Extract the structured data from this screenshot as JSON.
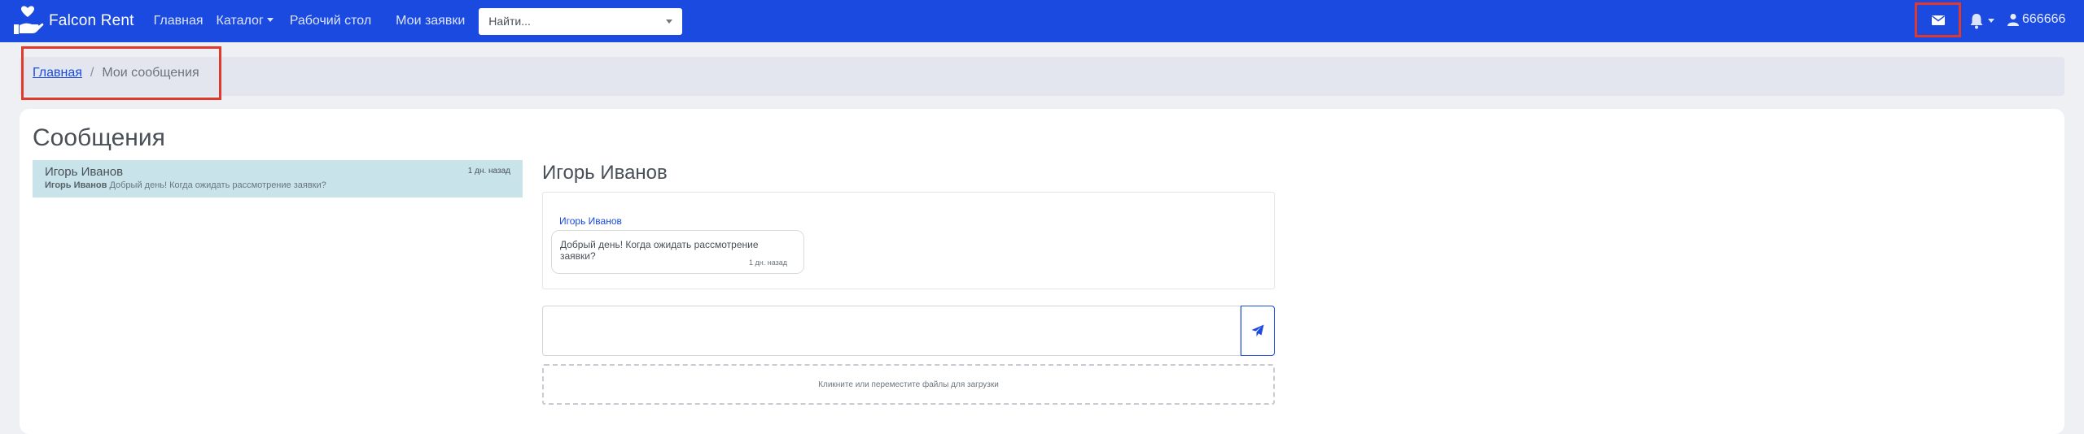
{
  "navbar": {
    "brand": "Falcon Rent",
    "links": [
      "Главная",
      "Каталог",
      "Рабочий стол",
      "Мои заявки"
    ],
    "search_placeholder": "Найти...",
    "user_label": "666666",
    "icons": {
      "logo": "hand-heart-icon",
      "mail": "envelope-icon",
      "bell": "bell-icon",
      "user": "user-icon"
    },
    "colors": {
      "navbar_bg": "#1a4ae0",
      "highlight_border": "#e03a2f"
    }
  },
  "breadcrumb": {
    "home": "Главная",
    "current": "Мои сообщения"
  },
  "page": {
    "title": "Сообщения"
  },
  "conversations": [
    {
      "name": "Игорь Иванов",
      "time": "1 дн. назад",
      "preview_author": "Игорь Иванов",
      "preview_text": "Добрый день! Когда ожидать рассмотрение заявки?"
    }
  ],
  "chat": {
    "title": "Игорь Иванов",
    "messages": [
      {
        "author": "Игорь Иванов",
        "text": "Добрый день! Когда ожидать рассмотрение заявки?",
        "time": "1 дн. назад"
      }
    ],
    "input_value": "",
    "dropzone_text": "Кликните или переместите файлы для загрузки"
  }
}
